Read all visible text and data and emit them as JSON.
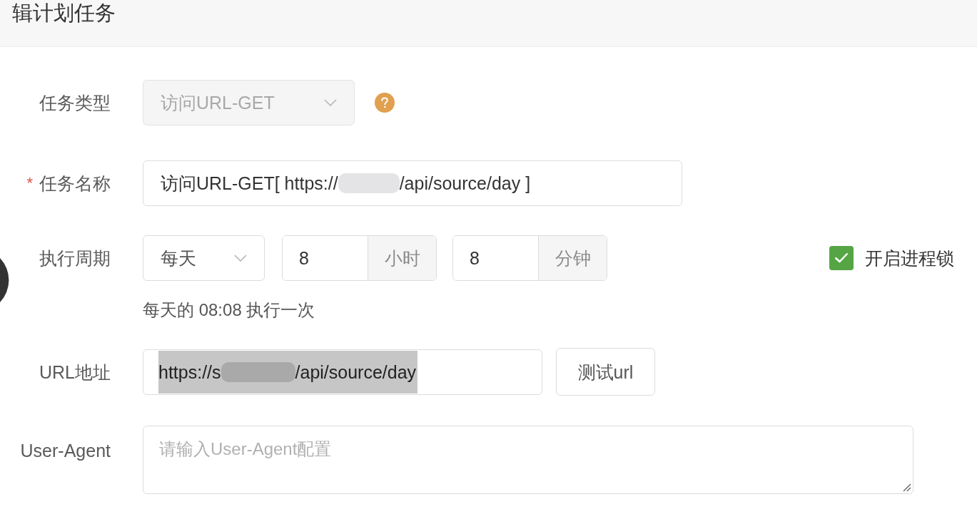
{
  "dialog": {
    "title": "辑计划任务"
  },
  "fields": [
    {
      "kind": "select",
      "label": "任务类型",
      "value": "访问URL-GET",
      "disabled": true
    },
    {
      "kind": "text",
      "required_mark": "*",
      "label": "任务名称",
      "value_segments": [
        {
          "kind": "text",
          "text": "访问URL-GET[ https://"
        },
        {
          "kind": "redacted"
        },
        {
          "kind": "text",
          "text": "/api/source/day ]"
        }
      ]
    },
    {
      "kind": "schedule",
      "label": "执行周期",
      "period": {
        "value": "每天",
        "disabled": false
      },
      "hour": {
        "value": "8",
        "unit": "小时"
      },
      "minute": {
        "value": "8",
        "unit": "分钟"
      },
      "lock": {
        "label": "开启进程锁",
        "checked": true
      },
      "hint": "每天的 08:08 执行一次"
    },
    {
      "kind": "url",
      "label": "URL地址",
      "text_highlighted": true,
      "value_segments": [
        {
          "kind": "text",
          "text": "https://s"
        },
        {
          "kind": "redacted"
        },
        {
          "kind": "text",
          "text": "/api/source/day"
        }
      ],
      "button": "测试url"
    },
    {
      "kind": "textarea",
      "label": "User-Agent",
      "placeholder": "请输入User-Agent配置"
    }
  ]
}
